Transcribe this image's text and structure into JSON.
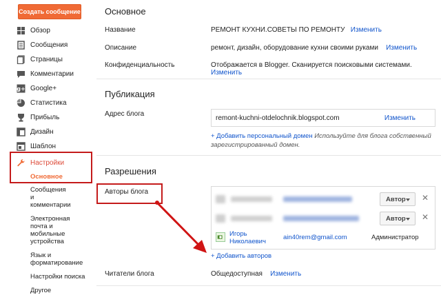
{
  "sidebar": {
    "create_label": "Создать сообщение",
    "items": [
      {
        "label": "Обзор",
        "icon": "overview-icon"
      },
      {
        "label": "Сообщения",
        "icon": "posts-icon"
      },
      {
        "label": "Страницы",
        "icon": "pages-icon"
      },
      {
        "label": "Комментарии",
        "icon": "comments-icon"
      },
      {
        "label": "Google+",
        "icon": "google-plus-icon"
      },
      {
        "label": "Статистика",
        "icon": "stats-icon"
      },
      {
        "label": "Прибыль",
        "icon": "earnings-icon"
      },
      {
        "label": "Дизайн",
        "icon": "layout-icon"
      },
      {
        "label": "Шаблон",
        "icon": "template-icon"
      },
      {
        "label": "Настройки",
        "icon": "wrench-icon"
      }
    ],
    "sub": [
      {
        "label": "Основное"
      },
      {
        "label": "Сообщения и комментарии"
      },
      {
        "label": "Электронная почта и мобильные устройства"
      },
      {
        "label": "Язык и форматирование"
      },
      {
        "label": "Настройки поиска"
      },
      {
        "label": "Другое"
      }
    ]
  },
  "basic": {
    "title": "Основное",
    "name_label": "Название",
    "name_value": "РЕМОНТ КУХНИ.СОВЕТЫ ПО РЕМОНТУ",
    "desc_label": "Описание",
    "desc_value": "ремонт, дизайн, оборудование кухни своими руками",
    "privacy_label": "Конфиденциальность",
    "privacy_value": "Отображается в Blogger. Сканируется поисковыми системами.",
    "edit": "Изменить"
  },
  "publishing": {
    "title": "Публикация",
    "address_label": "Адрес блога",
    "address_value": "remont-kuchni-otdelochnik.blogspot.com",
    "add_domain": "+ Добавить персональный домен",
    "domain_hint": "Используйте для блога собственный зарегистрированный домен."
  },
  "permissions": {
    "title": "Разрешения",
    "authors_label": "Авторы блога",
    "role_author": "Автор",
    "author_name": "Игорь Николаевич",
    "author_email": "ain40rem@gmail.com",
    "admin_role": "Администратор",
    "add_authors": "+ Добавить авторов",
    "readers_label": "Читатели блога",
    "readers_value": "Общедоступная"
  },
  "colors": {
    "accent": "#f06a35",
    "link": "#1155cc",
    "highlight": "#c41a1a"
  }
}
